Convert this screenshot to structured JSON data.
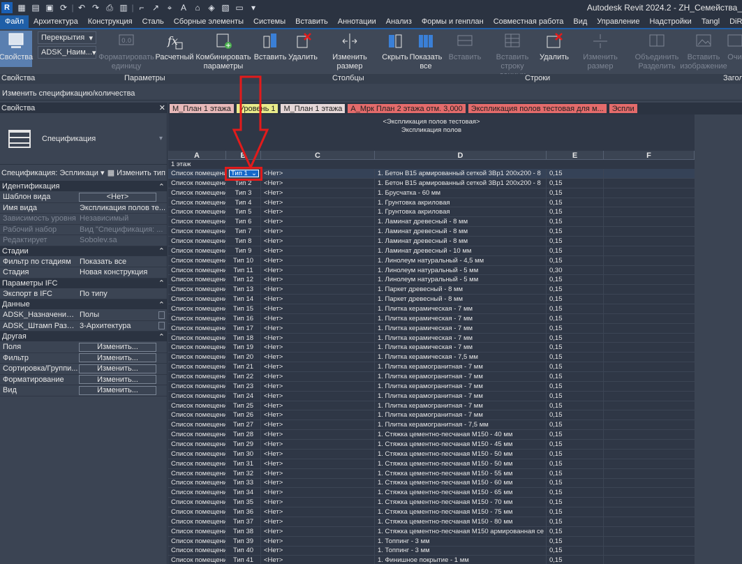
{
  "app": {
    "title": "Autodesk Revit 2024.2 - ZH_Семейства_"
  },
  "menu": [
    "Файл",
    "Архитектура",
    "Конструкция",
    "Сталь",
    "Сборные элементы",
    "Системы",
    "Вставить",
    "Аннотации",
    "Анализ",
    "Формы и генплан",
    "Совместная работа",
    "Вид",
    "Управление",
    "Надстройки",
    "Tangl",
    "DiRo"
  ],
  "ribbon": {
    "properties": "Свойства",
    "category_select": "Перекрытия",
    "name_select": "ADSK_Наим...",
    "format_unit": "Форматировать единицу",
    "calculated": "Расчетный",
    "combine": "Комбинировать параметры",
    "insert": "Вставить",
    "delete": "Удалить",
    "resize": "Изменить размер",
    "hide": "Скрыть",
    "show_all": "Показать все",
    "row_insert": "Вставить",
    "row_insert_data": "Вставить строку данных",
    "row_delete": "Удалить",
    "row_resize": "Изменить размер",
    "merge": "Объединить Разделить",
    "insert_image": "Вставить изображение",
    "clear": "Очи"
  },
  "panels": {
    "properties": "Свойства",
    "parameters": "Параметры",
    "columns": "Столбцы",
    "rows": "Строки",
    "title": "Загол"
  },
  "context": "Изменить спецификацию/количества",
  "props": {
    "header": "Свойства",
    "close": "✕",
    "type": "Спецификация",
    "instance": "Спецификация: Эспликаци",
    "edit_type": "Изменить тип",
    "groups": [
      {
        "name": "Идентификация",
        "rows": [
          {
            "n": "Шаблон вида",
            "v": "<Нет>",
            "btn": true
          },
          {
            "n": "Имя вида",
            "v": "Экспликация полов те..."
          },
          {
            "n": "Зависимость уровня",
            "v": "Независимый",
            "gray": true
          },
          {
            "n": "Рабочий набор",
            "v": "Вид \"Спецификация: ...",
            "gray": true
          },
          {
            "n": "Редактирует",
            "v": "Sobolev.sa",
            "gray": true
          }
        ]
      },
      {
        "name": "Стадии",
        "rows": [
          {
            "n": "Фильтр по стадиям",
            "v": "Показать все"
          },
          {
            "n": "Стадия",
            "v": "Новая конструкция"
          }
        ]
      },
      {
        "name": "Параметры IFC",
        "rows": [
          {
            "n": "Экспорт в IFC",
            "v": "По типу"
          }
        ]
      },
      {
        "name": "Данные",
        "rows": [
          {
            "n": "ADSK_Назначение в...",
            "v": "Полы",
            "chk": true
          },
          {
            "n": "ADSK_Штамп Раздел ...",
            "v": "3-Архитектура",
            "chk": true
          }
        ]
      },
      {
        "name": "Другая",
        "rows": [
          {
            "n": "Поля",
            "v": "Изменить...",
            "btn": true
          },
          {
            "n": "Фильтр",
            "v": "Изменить...",
            "btn": true
          },
          {
            "n": "Сортировка/Группи...",
            "v": "Изменить...",
            "btn": true
          },
          {
            "n": "Форматирование",
            "v": "Изменить...",
            "btn": true
          },
          {
            "n": "Вид",
            "v": "Изменить...",
            "btn": true
          }
        ]
      }
    ]
  },
  "tabs": [
    {
      "label": "М_План 1 этажа",
      "color": "#e8b9b9"
    },
    {
      "label": "Уровень 1",
      "color": "#e9ec8a"
    },
    {
      "label": "М_План 1 этажа",
      "color": "#e6d8d8"
    },
    {
      "label": "А_Мрк План 2 этажа отм. 3,000",
      "color": "#e46b6b"
    },
    {
      "label": "Экспликация полов тестовая для м...",
      "color": "#e46b6b"
    },
    {
      "label": "Эспли",
      "color": "#e46b6b"
    }
  ],
  "schedule": {
    "title1": "<Экспликация полов тестовая>",
    "title2": "Экспликация полов",
    "columns": [
      "A",
      "B",
      "C",
      "D",
      "E",
      "F"
    ],
    "group": "1 этаж",
    "dropdown": "Тип 1",
    "rows": [
      [
        "Список помещени",
        "Тип 1",
        "<Нет>",
        "1. Бетон В15 армированный сеткой 3Вр1 200х200 - 8",
        "0,15"
      ],
      [
        "Список помещени",
        "Тип 2",
        "<Нет>",
        "1. Бетон В15 армированный сеткой 3Вр1 200х200 - 8",
        "0,15"
      ],
      [
        "Список помещени",
        "Тип 3",
        "<Нет>",
        "1. Брусчатка - 60 мм",
        "0,15"
      ],
      [
        "Список помещени",
        "Тип 4",
        "<Нет>",
        "1. Грунтовка акриловая",
        "0,15"
      ],
      [
        "Список помещени",
        "Тип 5",
        "<Нет>",
        "1. Грунтовка акриловая",
        "0,15"
      ],
      [
        "Список помещени",
        "Тип 6",
        "<Нет>",
        "1. Ламинат древесный - 8 мм",
        "0,15"
      ],
      [
        "Список помещени",
        "Тип 7",
        "<Нет>",
        "1. Ламинат древесный - 8 мм",
        "0,15"
      ],
      [
        "Список помещени",
        "Тип 8",
        "<Нет>",
        "1. Ламинат древесный - 8 мм",
        "0,15"
      ],
      [
        "Список помещени",
        "Тип 9",
        "<Нет>",
        "1. Ламинат древесный - 10 мм",
        "0,15"
      ],
      [
        "Список помещени",
        "Тип 10",
        "<Нет>",
        "1. Линолеум натуральный - 4,5 мм",
        "0,15"
      ],
      [
        "Список помещени",
        "Тип 11",
        "<Нет>",
        "1. Линолеум натуральный - 5 мм",
        "0,30"
      ],
      [
        "Список помещени",
        "Тип 12",
        "<Нет>",
        "1. Линолеум натуральный - 5 мм",
        "0,15"
      ],
      [
        "Список помещени",
        "Тип 13",
        "<Нет>",
        "1. Паркет древесный - 8 мм",
        "0,15"
      ],
      [
        "Список помещени",
        "Тип 14",
        "<Нет>",
        "1. Паркет древесный - 8 мм",
        "0,15"
      ],
      [
        "Список помещени",
        "Тип 15",
        "<Нет>",
        "1. Плитка керамическая - 7 мм",
        "0,15"
      ],
      [
        "Список помещени",
        "Тип 16",
        "<Нет>",
        "1. Плитка керамическая - 7 мм",
        "0,15"
      ],
      [
        "Список помещени",
        "Тип 17",
        "<Нет>",
        "1. Плитка керамическая - 7 мм",
        "0,15"
      ],
      [
        "Список помещени",
        "Тип 18",
        "<Нет>",
        "1. Плитка керамическая - 7 мм",
        "0,15"
      ],
      [
        "Список помещени",
        "Тип 19",
        "<Нет>",
        "1. Плитка керамическая - 7 мм",
        "0,15"
      ],
      [
        "Список помещени",
        "Тип 20",
        "<Нет>",
        "1. Плитка керамическая - 7,5 мм",
        "0,15"
      ],
      [
        "Список помещени",
        "Тип 21",
        "<Нет>",
        "1. Плитка керамогранитная - 7 мм",
        "0,15"
      ],
      [
        "Список помещени",
        "Тип 22",
        "<Нет>",
        "1. Плитка керамогранитная - 7 мм",
        "0,15"
      ],
      [
        "Список помещени",
        "Тип 23",
        "<Нет>",
        "1. Плитка керамогранитная - 7 мм",
        "0,15"
      ],
      [
        "Список помещени",
        "Тип 24",
        "<Нет>",
        "1. Плитка керамогранитная - 7 мм",
        "0,15"
      ],
      [
        "Список помещени",
        "Тип 25",
        "<Нет>",
        "1. Плитка керамогранитная - 7 мм",
        "0,15"
      ],
      [
        "Список помещени",
        "Тип 26",
        "<Нет>",
        "1. Плитка керамогранитная - 7 мм",
        "0,15"
      ],
      [
        "Список помещени",
        "Тип 27",
        "<Нет>",
        "1. Плитка керамогранитная - 7,5 мм",
        "0,15"
      ],
      [
        "Список помещени",
        "Тип 28",
        "<Нет>",
        "1. Стяжка цементно-песчаная М150 - 40 мм",
        "0,15"
      ],
      [
        "Список помещени",
        "Тип 29",
        "<Нет>",
        "1. Стяжка цементно-песчаная М150 - 45 мм",
        "0,15"
      ],
      [
        "Список помещени",
        "Тип 30",
        "<Нет>",
        "1. Стяжка цементно-песчаная М150 - 50 мм",
        "0,15"
      ],
      [
        "Список помещени",
        "Тип 31",
        "<Нет>",
        "1. Стяжка цементно-песчаная М150 - 50 мм",
        "0,15"
      ],
      [
        "Список помещени",
        "Тип 32",
        "<Нет>",
        "1. Стяжка цементно-песчаная М150 - 55 мм",
        "0,15"
      ],
      [
        "Список помещени",
        "Тип 33",
        "<Нет>",
        "1. Стяжка цементно-песчаная М150 - 60 мм",
        "0,15"
      ],
      [
        "Список помещени",
        "Тип 34",
        "<Нет>",
        "1. Стяжка цементно-песчаная М150 - 65 мм",
        "0,15"
      ],
      [
        "Список помещени",
        "Тип 35",
        "<Нет>",
        "1. Стяжка цементно-песчаная М150 - 70 мм",
        "0,15"
      ],
      [
        "Список помещени",
        "Тип 36",
        "<Нет>",
        "1. Стяжка цементно-песчаная М150 - 75 мм",
        "0,15"
      ],
      [
        "Список помещени",
        "Тип 37",
        "<Нет>",
        "1. Стяжка цементно-песчаная М150 - 80 мм",
        "0,15"
      ],
      [
        "Список помещени",
        "Тип 38",
        "<Нет>",
        "1. Стяжка цементно-песчаная М150 армированная се",
        "0,15"
      ],
      [
        "Список помещени",
        "Тип 39",
        "<Нет>",
        "1. Топпинг - 3 мм",
        "0,15"
      ],
      [
        "Список помещени",
        "Тип 40",
        "<Нет>",
        "1. Топпинг - 3 мм",
        "0,15"
      ],
      [
        "Список помещени",
        "Тип 41",
        "<Нет>",
        "1. Финишное покрытие - 1 мм",
        "0,15"
      ]
    ]
  },
  "colors": {
    "accent": "#1f5fa8",
    "annotation": "#e21b1b",
    "dropdown": "#1668c9"
  }
}
